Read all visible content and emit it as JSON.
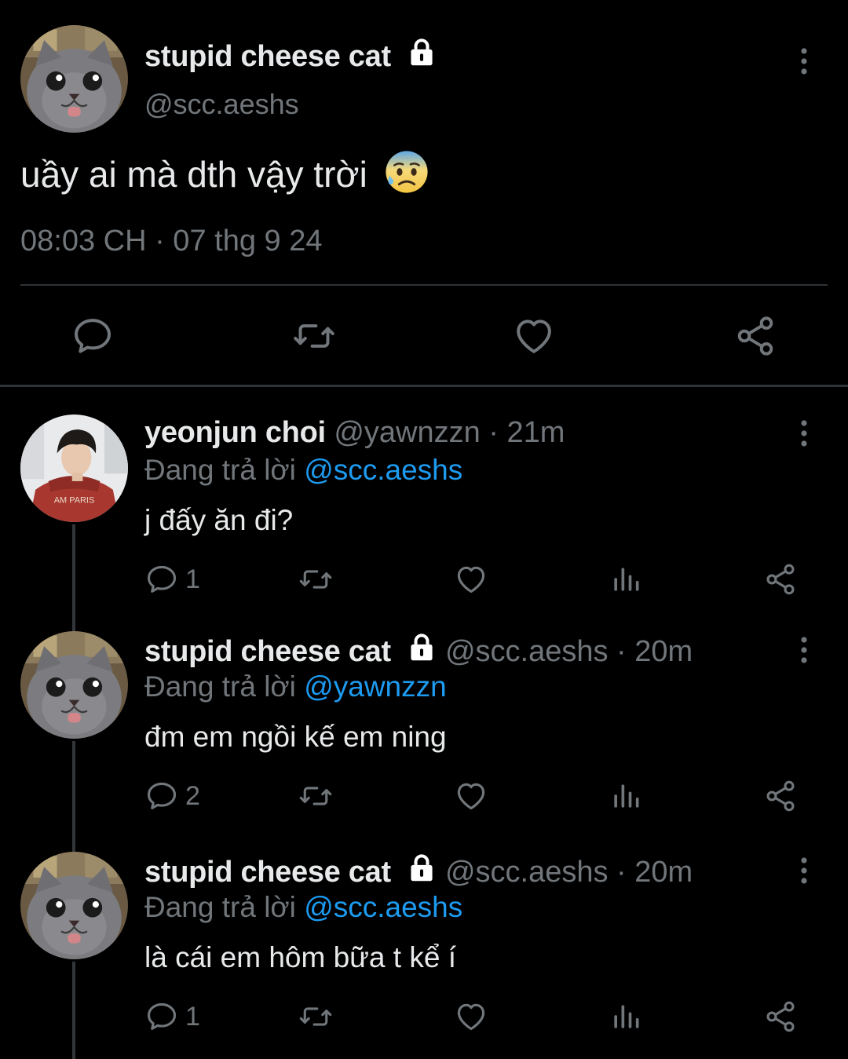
{
  "main_tweet": {
    "author_name": "stupid cheese cat",
    "handle": "@scc.aeshs",
    "text": "uầy ai mà dth vậy trời",
    "timestamp": "08:03 CH · 07 thg 9 24",
    "emoji": "anxious-face-with-sweat",
    "locked": true
  },
  "replies": [
    {
      "author_name": "yeonjun choi",
      "meta": "@yawnzzn · 21m",
      "replying_prefix": "Đang trả lời",
      "replying_to": "@scc.aeshs",
      "text": "j đấy ăn đi?",
      "reply_count": "1",
      "locked": false
    },
    {
      "author_name": "stupid cheese cat",
      "meta": "@scc.aeshs · 20m",
      "replying_prefix": "Đang trả lời",
      "replying_to": "@yawnzzn",
      "text": "đm em ngồi kế em ning",
      "reply_count": "2",
      "locked": true
    },
    {
      "author_name": "stupid cheese cat",
      "meta": "@scc.aeshs · 20m",
      "replying_prefix": "Đang trả lời",
      "replying_to": "@scc.aeshs",
      "text": "là cái em hôm bữa t kể í",
      "reply_count": "1",
      "locked": true
    }
  ],
  "colors": {
    "background": "#000000",
    "text": "#e7e9ea",
    "secondary_text": "#71767b",
    "link": "#1d9bf0",
    "divider": "#2f3336"
  }
}
